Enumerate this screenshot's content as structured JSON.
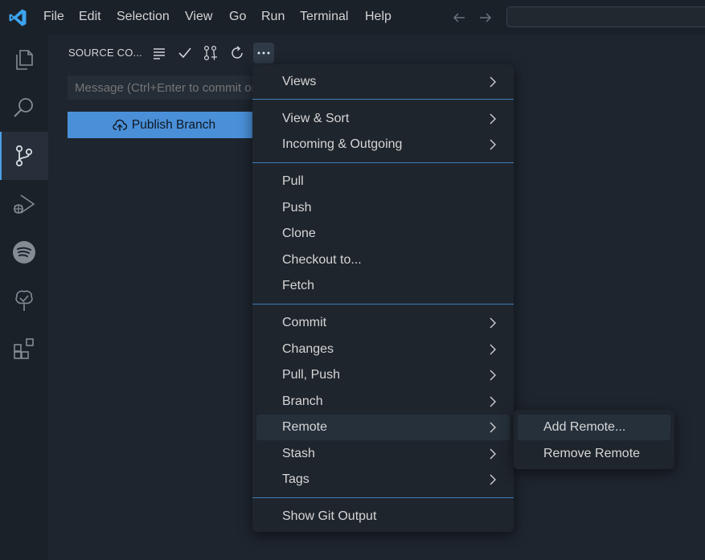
{
  "menubar": {
    "items": [
      "File",
      "Edit",
      "Selection",
      "View",
      "Go",
      "Run",
      "Terminal",
      "Help"
    ]
  },
  "activity_bar": {
    "icons": [
      "explorer-icon",
      "search-icon",
      "source-control-icon",
      "run-debug-icon",
      "spotify-icon",
      "tree-icon",
      "extensions-icon"
    ],
    "active": "source-control-icon"
  },
  "source_control": {
    "title": "SOURCE CO...",
    "message_placeholder": "Message (Ctrl+Enter to commit on 'main')",
    "publish_label": "Publish Branch"
  },
  "context_menu": {
    "groups": [
      [
        {
          "label": "Views",
          "submenu": true
        }
      ],
      [
        {
          "label": "View & Sort",
          "submenu": true
        },
        {
          "label": "Incoming & Outgoing",
          "submenu": true
        }
      ],
      [
        {
          "label": "Pull",
          "submenu": false
        },
        {
          "label": "Push",
          "submenu": false
        },
        {
          "label": "Clone",
          "submenu": false
        },
        {
          "label": "Checkout to...",
          "submenu": false
        },
        {
          "label": "Fetch",
          "submenu": false
        }
      ],
      [
        {
          "label": "Commit",
          "submenu": true
        },
        {
          "label": "Changes",
          "submenu": true
        },
        {
          "label": "Pull, Push",
          "submenu": true
        },
        {
          "label": "Branch",
          "submenu": true
        },
        {
          "label": "Remote",
          "submenu": true
        },
        {
          "label": "Stash",
          "submenu": true
        },
        {
          "label": "Tags",
          "submenu": true
        }
      ],
      [
        {
          "label": "Show Git Output",
          "submenu": false
        }
      ]
    ],
    "highlighted": "Remote"
  },
  "remote_submenu": {
    "items": [
      "Add Remote...",
      "Remove Remote"
    ],
    "highlighted": "Add Remote..."
  },
  "colors": {
    "accent": "#4a90d9",
    "separator": "#3e7fb8",
    "background": "#1b2129"
  }
}
